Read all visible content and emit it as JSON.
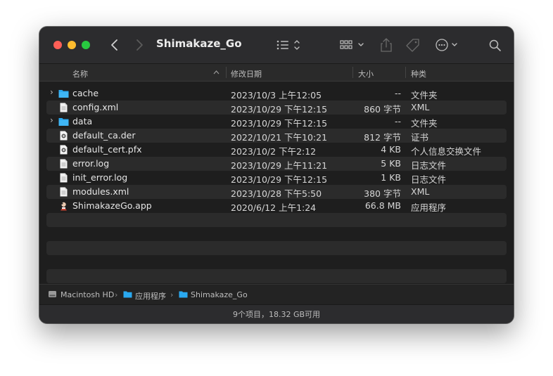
{
  "window": {
    "title": "Shimakaze_Go"
  },
  "columns": {
    "name": "名称",
    "date": "修改日期",
    "size": "大小",
    "kind": "种类"
  },
  "files": [
    {
      "name": "cache",
      "date": "2023/10/3 上午12:05",
      "size": "--",
      "kind": "文件夹",
      "icon": "folder-icon",
      "expandable": true
    },
    {
      "name": "config.xml",
      "date": "2023/10/29 下午12:15",
      "size": "860 字节",
      "kind": "XML",
      "icon": "document-icon",
      "expandable": false
    },
    {
      "name": "data",
      "date": "2023/10/29 下午12:15",
      "size": "--",
      "kind": "文件夹",
      "icon": "folder-icon",
      "expandable": true
    },
    {
      "name": "default_ca.der",
      "date": "2022/10/21 下午10:21",
      "size": "812 字节",
      "kind": "证书",
      "icon": "certificate-icon",
      "expandable": false
    },
    {
      "name": "default_cert.pfx",
      "date": "2023/10/2 下午2:12",
      "size": "4 KB",
      "kind": "个人信息交换文件",
      "icon": "certificate-icon",
      "expandable": false
    },
    {
      "name": "error.log",
      "date": "2023/10/29 上午11:21",
      "size": "5 KB",
      "kind": "日志文件",
      "icon": "document-icon",
      "expandable": false
    },
    {
      "name": "init_error.log",
      "date": "2023/10/29 下午12:15",
      "size": "1 KB",
      "kind": "日志文件",
      "icon": "document-icon",
      "expandable": false
    },
    {
      "name": "modules.xml",
      "date": "2023/10/28 下午5:50",
      "size": "380 字节",
      "kind": "XML",
      "icon": "document-icon",
      "expandable": false
    },
    {
      "name": "ShimakazeGo.app",
      "date": "2020/6/12 上午1:24",
      "size": "66.8 MB",
      "kind": "应用程序",
      "icon": "app-icon",
      "expandable": false
    }
  ],
  "pathbar": {
    "disk": "Macintosh HD",
    "apps": "应用程序",
    "folder": "Shimakaze_Go"
  },
  "status": {
    "text": "9个项目，18.32 GB可用"
  },
  "colors": {
    "folder": "#2aa9f0",
    "close": "#ff5f57",
    "minimize": "#febc2e",
    "zoom": "#28c840"
  }
}
